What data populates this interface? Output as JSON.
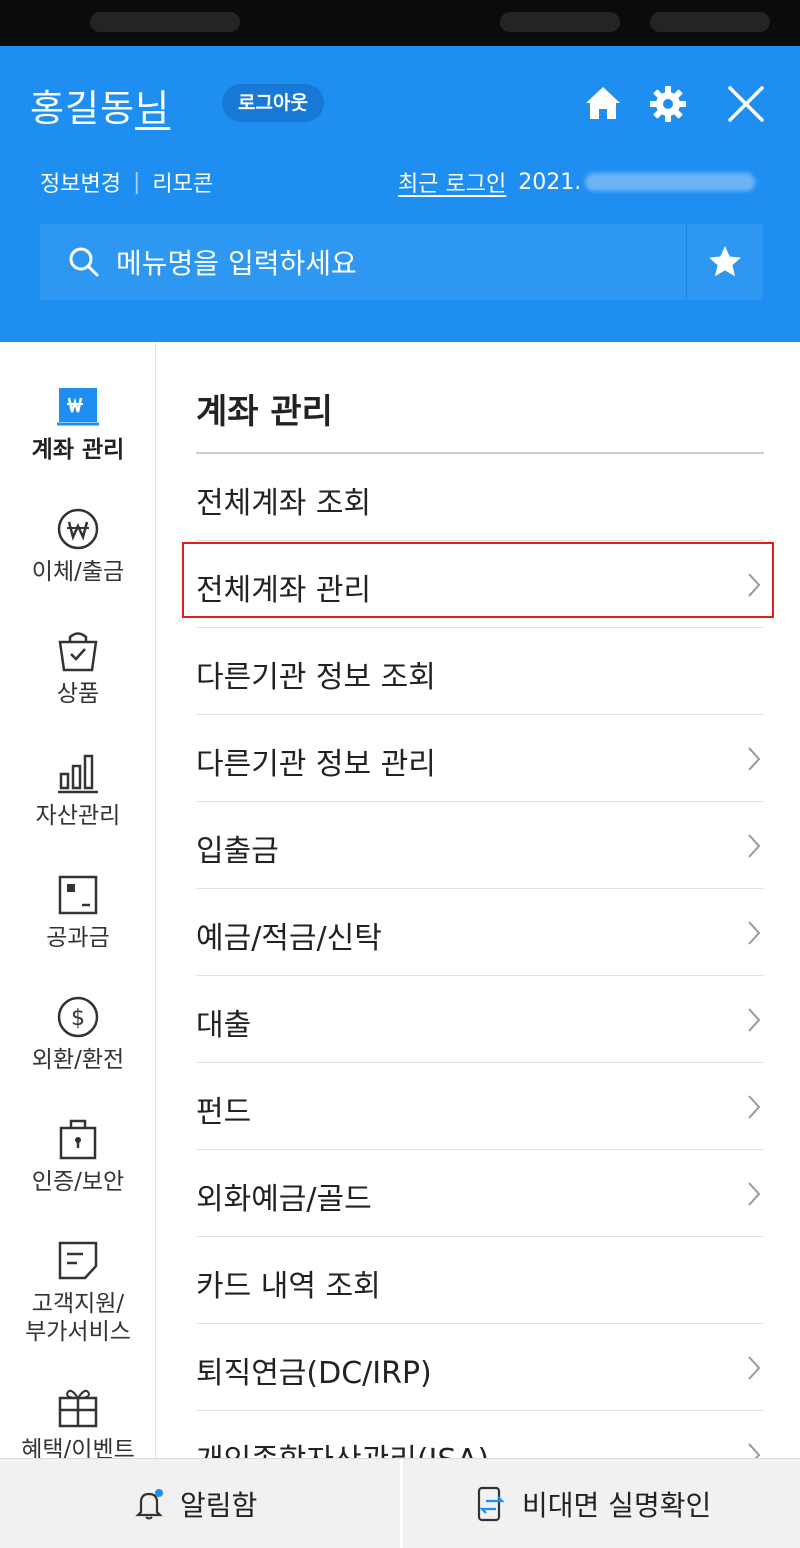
{
  "header": {
    "user_name": "홍길동",
    "user_suffix": "님",
    "logout_label": "로그아웃",
    "profile_edit": "정보변경",
    "separator": "|",
    "remote": "리모콘",
    "recent_login_label": "최근 로그인",
    "recent_login_value": "2021."
  },
  "search": {
    "placeholder": "메뉴명을 입력하세요"
  },
  "sidebar": {
    "items": [
      {
        "label": "계좌 관리",
        "icon": "won-screen-icon"
      },
      {
        "label": "이체/출금",
        "icon": "won-circle-icon"
      },
      {
        "label": "상품",
        "icon": "shopping-bag-icon"
      },
      {
        "label": "자산관리",
        "icon": "bar-chart-icon"
      },
      {
        "label": "공과금",
        "icon": "bill-icon"
      },
      {
        "label": "외환/환전",
        "icon": "dollar-circle-icon"
      },
      {
        "label": "인증/보안",
        "icon": "lock-icon"
      },
      {
        "label": "고객지원/\n부가서비스",
        "icon": "chat-icon"
      },
      {
        "label": "혜택/이벤트",
        "icon": "gift-icon"
      }
    ]
  },
  "content": {
    "section_title": "계좌 관리",
    "menu": [
      {
        "label": "전체계좌 조회",
        "chevron": false
      },
      {
        "label": "전체계좌 관리",
        "chevron": true
      },
      {
        "label": "다른기관 정보 조회",
        "chevron": false
      },
      {
        "label": "다른기관 정보 관리",
        "chevron": true
      },
      {
        "label": "입출금",
        "chevron": true
      },
      {
        "label": "예금/적금/신탁",
        "chevron": true
      },
      {
        "label": "대출",
        "chevron": true
      },
      {
        "label": "펀드",
        "chevron": true
      },
      {
        "label": "외화예금/골드",
        "chevron": true
      },
      {
        "label": "카드 내역 조회",
        "chevron": false
      },
      {
        "label": "퇴직연금(DC/IRP)",
        "chevron": true
      },
      {
        "label": "개인종합자산관리(ISA)",
        "chevron": true
      }
    ]
  },
  "bottom": {
    "notifications": "알림함",
    "verify": "비대면 실명확인"
  },
  "colors": {
    "header_bg": "#1f8ef1",
    "search_bg": "#2e97f2",
    "highlight": "#e02020",
    "accent_icon": "#1f8ef1"
  }
}
